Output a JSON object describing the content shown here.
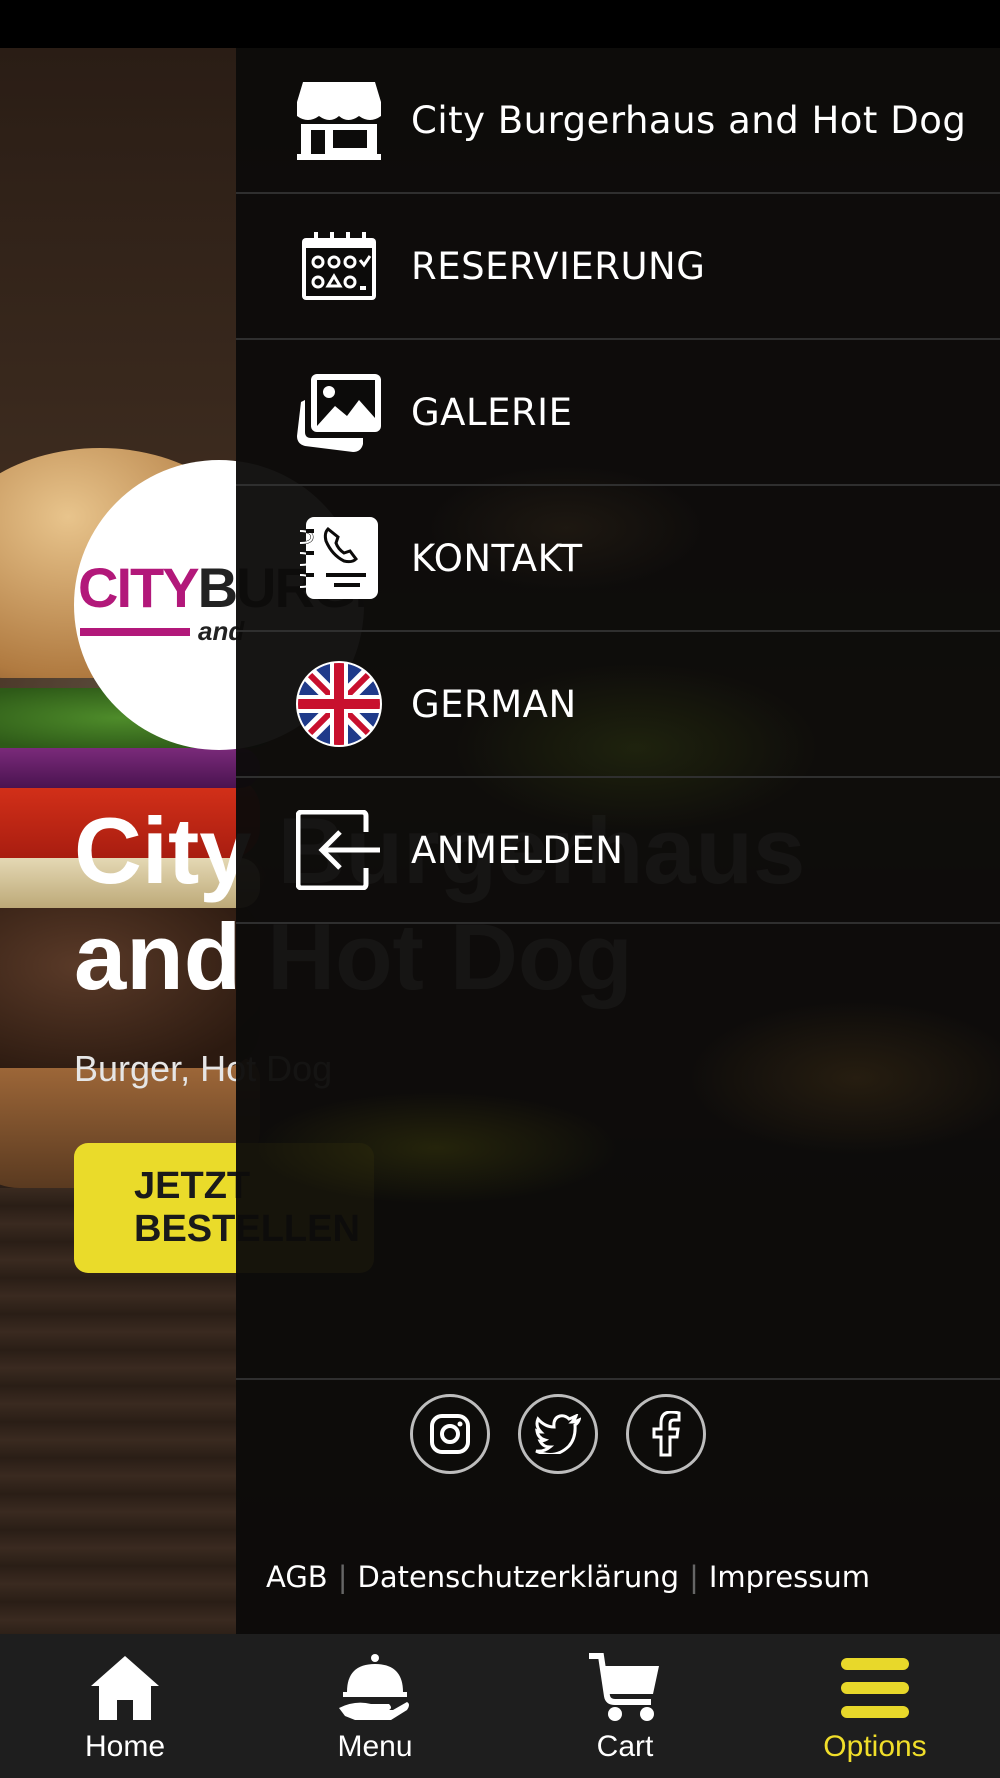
{
  "background": {
    "logo": {
      "pink": "CITY",
      "dark": "BURGERHAUS",
      "sub": "and"
    },
    "hero_title": "City Burgerhaus\nand Hot Dog",
    "hero_subtitle": "Burger, Hot Dog",
    "hero_button": "JETZT BESTELLEN"
  },
  "drawer": {
    "items": [
      {
        "label": "City Burgerhaus and Hot Dog",
        "icon": "store-icon"
      },
      {
        "label": "RESERVIERUNG",
        "icon": "calendar-icon"
      },
      {
        "label": "GALERIE",
        "icon": "gallery-icon"
      },
      {
        "label": "KONTAKT",
        "icon": "contact-book-icon"
      },
      {
        "label": "GERMAN",
        "icon": "uk-flag-icon"
      },
      {
        "label": "ANMELDEN",
        "icon": "login-icon"
      }
    ],
    "social": [
      "instagram-icon",
      "twitter-icon",
      "facebook-icon"
    ],
    "footer": {
      "agb": "AGB",
      "privacy": "Datenschutzerklärung",
      "imprint": "Impressum"
    }
  },
  "bottom_nav": {
    "items": [
      {
        "label": "Home",
        "icon": "home-icon"
      },
      {
        "label": "Menu",
        "icon": "cloche-icon"
      },
      {
        "label": "Cart",
        "icon": "cart-icon"
      },
      {
        "label": "Options",
        "icon": "menu-bars-icon"
      }
    ],
    "active": "Options",
    "active_color": "#f0de2a"
  },
  "colors": {
    "accent": "#eadb2a",
    "logo_pink": "#b2187a"
  }
}
